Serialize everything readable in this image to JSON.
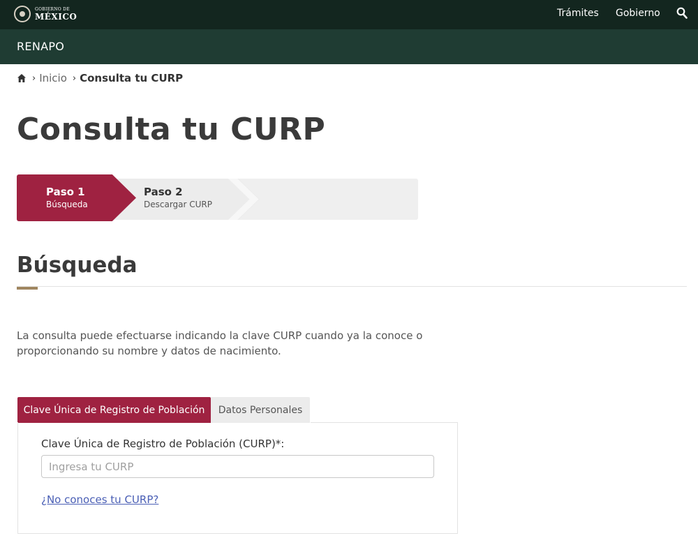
{
  "header": {
    "logo_small": "GOBIERNO DE",
    "logo_big": "MÉXICO",
    "nav": [
      {
        "label": "Trámites"
      },
      {
        "label": "Gobierno"
      }
    ],
    "search_icon": "search-icon",
    "bg_color": "#13261f"
  },
  "subheader": {
    "title": "RENAPO",
    "bg_color": "#1f3c33"
  },
  "breadcrumb": {
    "home_icon": "home-icon",
    "items": [
      {
        "label": "Inicio"
      },
      {
        "label": "Consulta tu CURP"
      }
    ]
  },
  "page": {
    "title": "Consulta tu CURP"
  },
  "stepper": {
    "active_color": "#9f2241",
    "steps": [
      {
        "label": "Paso 1",
        "sub": "Búsqueda",
        "active": true
      },
      {
        "label": "Paso 2",
        "sub": "Descargar CURP",
        "active": false
      }
    ]
  },
  "section": {
    "title": "Búsqueda",
    "accent_color": "#a08660",
    "description": "La consulta puede efectuarse indicando la clave CURP cuando ya la conoce o proporcionando su nombre y datos de nacimiento."
  },
  "tabs": [
    {
      "label": "Clave Única de Registro de Población",
      "active": true
    },
    {
      "label": "Datos Personales",
      "active": false
    }
  ],
  "form": {
    "field_label": "Clave Única de Registro de Población (CURP)*:",
    "input_value": "",
    "input_placeholder": "Ingresa tu CURP",
    "help_link": "¿No conoces tu CURP?"
  }
}
